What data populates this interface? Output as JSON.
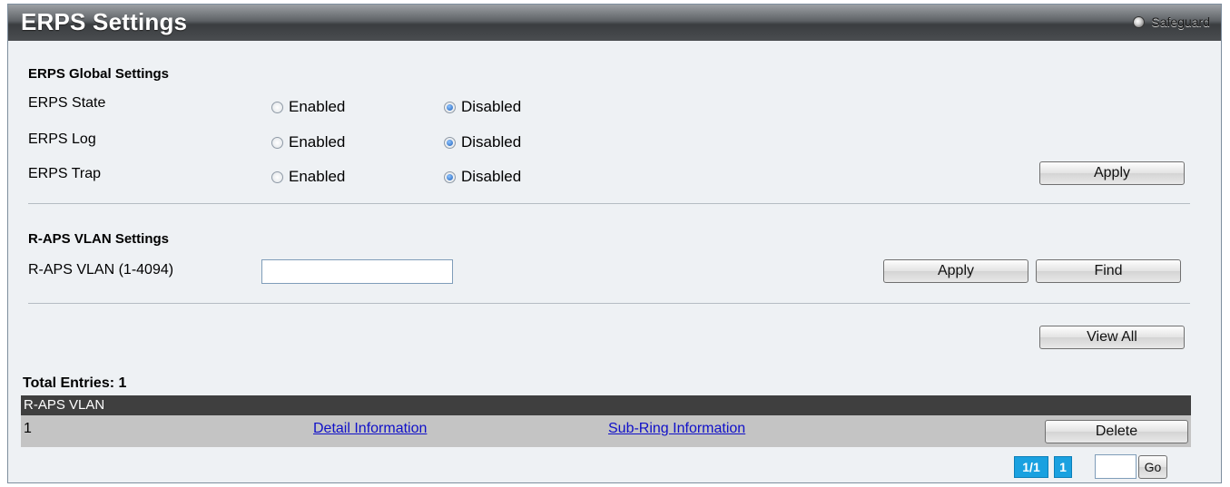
{
  "header": {
    "title": "ERPS Settings",
    "safeguard_label": "Safeguard"
  },
  "global_settings": {
    "section_title": "ERPS Global Settings",
    "rows": [
      {
        "label": "ERPS State",
        "options": [
          "Enabled",
          "Disabled"
        ],
        "selected": "Disabled"
      },
      {
        "label": "ERPS Log",
        "options": [
          "Enabled",
          "Disabled"
        ],
        "selected": "Disabled"
      },
      {
        "label": "ERPS Trap",
        "options": [
          "Enabled",
          "Disabled"
        ],
        "selected": "Disabled"
      }
    ],
    "apply_label": "Apply"
  },
  "raps_vlan_settings": {
    "section_title": "R-APS VLAN Settings",
    "field_label": "R-APS VLAN (1-4094)",
    "field_value": "",
    "apply_label": "Apply",
    "find_label": "Find"
  },
  "view_all_label": "View All",
  "table": {
    "total_entries_text": "Total Entries: 1",
    "header": "R-APS VLAN",
    "rows": [
      {
        "vlan": "1",
        "detail_link": "Detail Information",
        "subring_link": "Sub-Ring Information",
        "delete_label": "Delete"
      }
    ]
  },
  "pagination": {
    "page_status": "1/1",
    "current_page": "1",
    "page_input_value": "",
    "go_label": "Go"
  },
  "colors": {
    "panel_background": "#eef1f4",
    "table_header_background": "#3f3f3f",
    "table_row_background": "#c4c4c4",
    "link": "#1010c8",
    "pagination_accent": "#1aa1e0"
  }
}
